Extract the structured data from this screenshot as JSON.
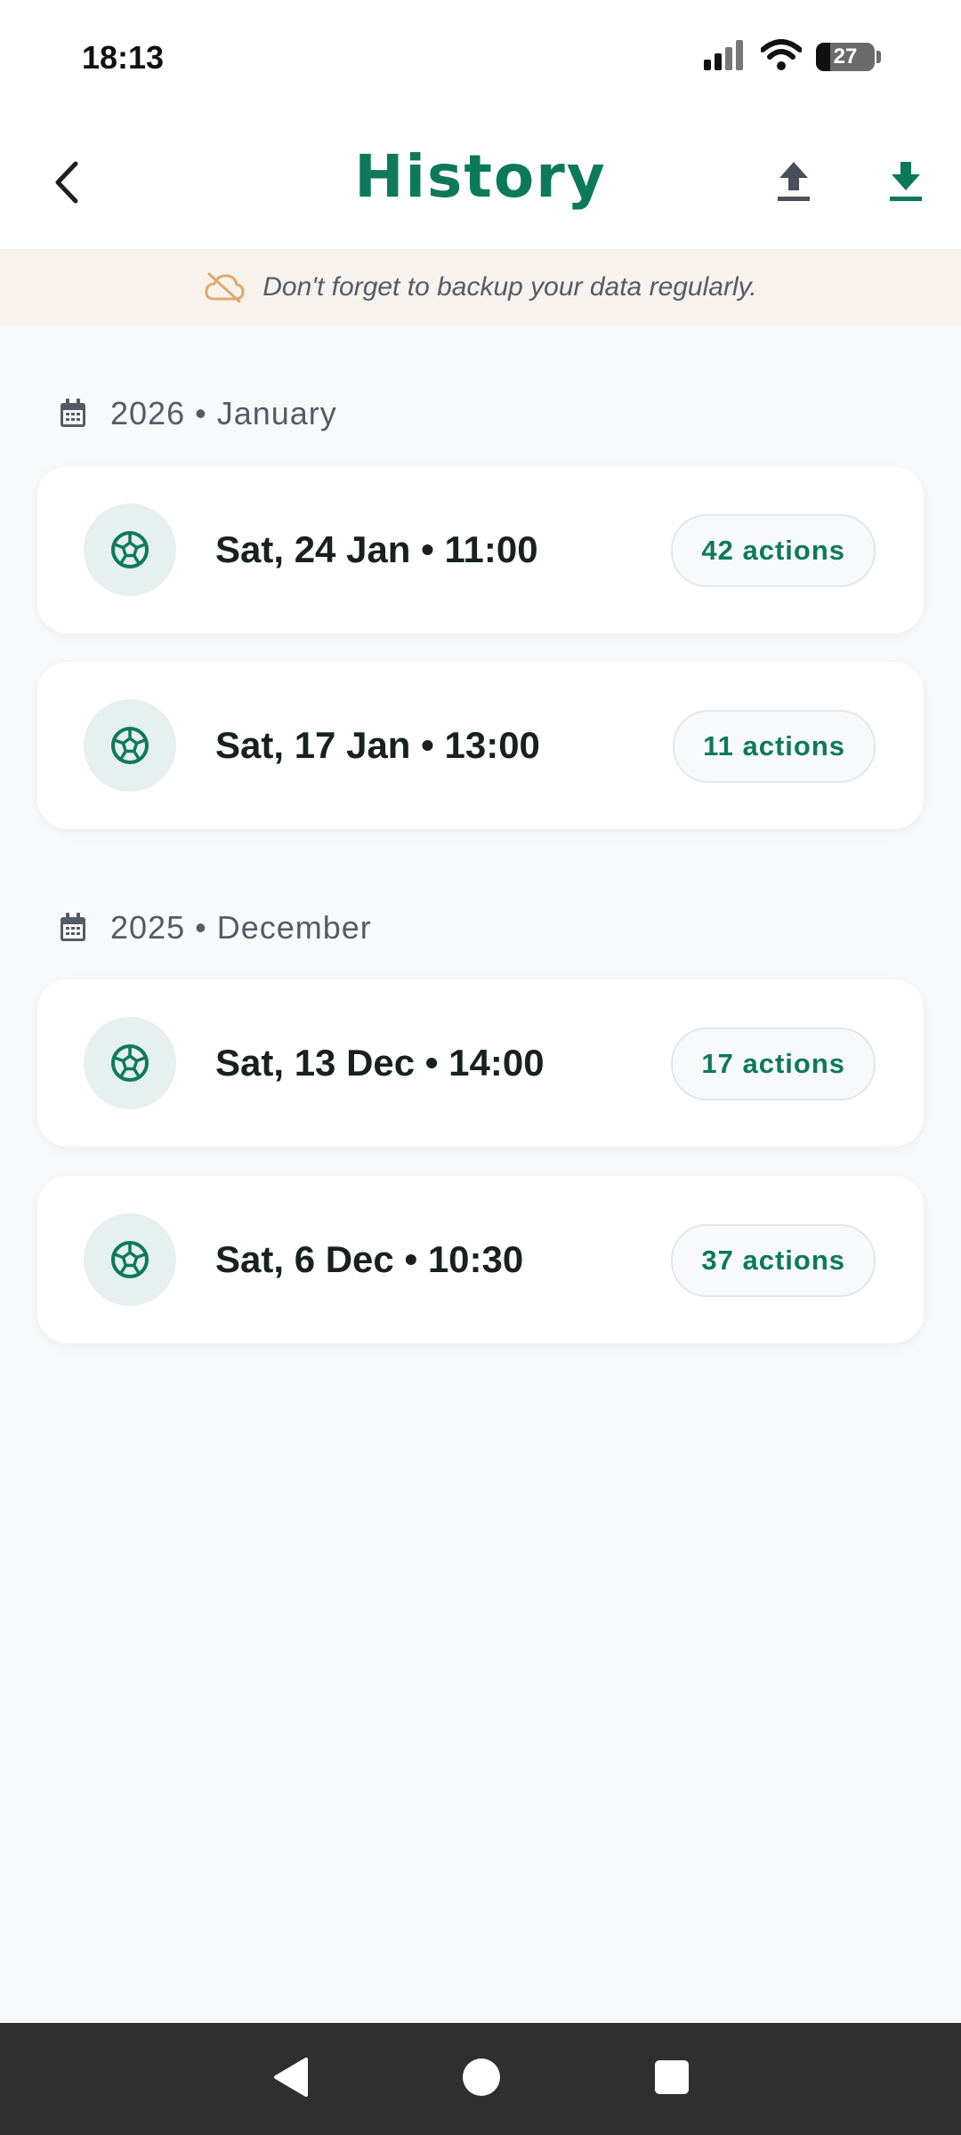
{
  "status_bar": {
    "time": "18:13",
    "battery_level": "27",
    "icons": [
      "signal-icon",
      "wifi-icon",
      "battery-icon"
    ]
  },
  "app_bar": {
    "title": "History",
    "icons": [
      "back-icon",
      "upload-icon",
      "download-icon"
    ]
  },
  "banner": {
    "icon": "cloud-off-icon",
    "text": "Don't forget to backup your data regularly."
  },
  "sections": [
    {
      "label": "2026 • January",
      "icon": "calendar-icon",
      "items": [
        {
          "title": "Sat, 24 Jan • 11:00",
          "badge": "42 actions",
          "icon": "soccer-ball-icon"
        },
        {
          "title": "Sat, 17 Jan • 13:00",
          "badge": "11 actions",
          "icon": "soccer-ball-icon"
        }
      ]
    },
    {
      "label": "2025 • December",
      "icon": "calendar-icon",
      "items": [
        {
          "title": "Sat, 13 Dec • 14:00",
          "badge": "17 actions",
          "icon": "soccer-ball-icon"
        },
        {
          "title": "Sat, 6 Dec • 10:30",
          "badge": "37 actions",
          "icon": "soccer-ball-icon"
        }
      ]
    }
  ],
  "colors": {
    "accent": "#0c7a5a",
    "banner_bg": "#f7f2ec",
    "banner_icon": "#e0a96d",
    "page_bg": "#f8f9fb",
    "nav_bg": "#2f2f2f"
  },
  "nav": {
    "icons": [
      "back-triangle-icon",
      "home-circle-icon",
      "recents-square-icon"
    ]
  }
}
